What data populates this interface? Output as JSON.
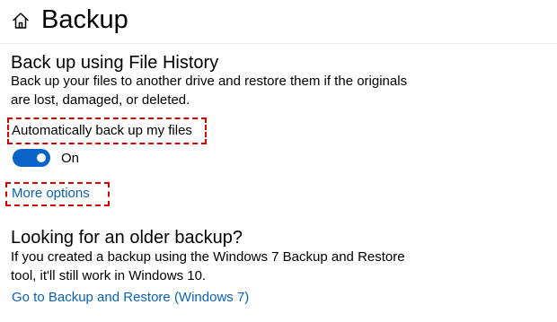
{
  "header": {
    "title": "Backup",
    "home_icon": "home-icon"
  },
  "file_history": {
    "title": "Back up using File History",
    "description_lines": [
      "Back up your files to another drive and restore them if the originals",
      "are lost, damaged, or deleted."
    ],
    "auto_backup_label": "Automatically back up my files",
    "toggle_state": "On",
    "toggle_on": true,
    "more_options_link": "More options"
  },
  "older_backup": {
    "title": "Looking for an older backup?",
    "description_lines": [
      "If you created a backup using the Windows 7 Backup and Restore",
      "tool, it'll still work in Windows 10."
    ],
    "restore_link": "Go to Backup and Restore (Windows 7)"
  },
  "colors": {
    "accent": "#0a64c8",
    "link": "#0b62b5",
    "highlight": "#d40000"
  }
}
